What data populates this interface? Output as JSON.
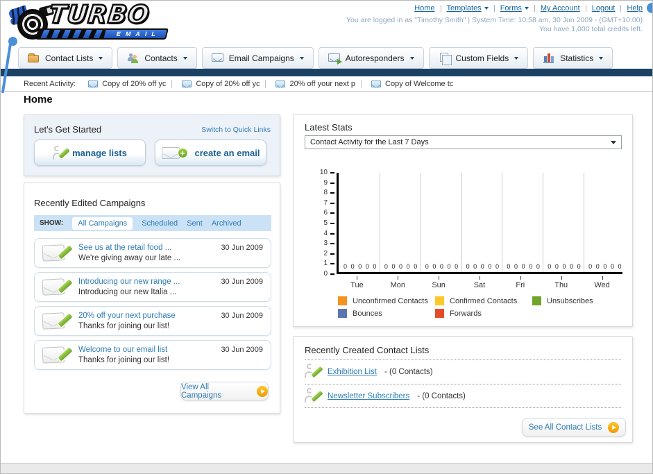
{
  "logo": {
    "title": "TURBO",
    "subtitle": "EMAIL"
  },
  "header": {
    "nav": [
      {
        "label": "Home",
        "dropdown": false
      },
      {
        "label": "Templates",
        "dropdown": true
      },
      {
        "label": "Forms",
        "dropdown": true
      },
      {
        "label": "My Account",
        "dropdown": false
      },
      {
        "label": "Logout",
        "dropdown": false
      },
      {
        "label": "Help",
        "dropdown": false
      }
    ],
    "login_info": "You are logged in as \"Timothy Smith\" | System Time: 10:58 am, 30 Jun 2009 - (GMT+10:00)",
    "credits_info": "You have 1,000 total credits left."
  },
  "tabs": [
    {
      "label": "Contact Lists"
    },
    {
      "label": "Contacts"
    },
    {
      "label": "Email Campaigns"
    },
    {
      "label": "Autoresponders"
    },
    {
      "label": "Custom Fields"
    },
    {
      "label": "Statistics"
    }
  ],
  "recent_activity": {
    "label": "Recent Activity:",
    "items": [
      {
        "text": "Copy of 20% off yc"
      },
      {
        "text": "Copy of 20% off yc"
      },
      {
        "text": "20% off your next p"
      },
      {
        "text": "Copy of Welcome tc"
      }
    ]
  },
  "page_title": "Home",
  "get_started": {
    "title": "Let's Get Started",
    "switch_link": "Switch to Quick Links",
    "manage_lists_label": "manage lists",
    "create_email_label": "create an email"
  },
  "campaigns_panel": {
    "title": "Recently Edited Campaigns",
    "show_label": "SHOW:",
    "filters": [
      {
        "label": "All Campaigns",
        "active": true
      },
      {
        "label": "Scheduled",
        "active": false
      },
      {
        "label": "Sent",
        "active": false
      },
      {
        "label": "Archived",
        "active": false
      }
    ],
    "rows": [
      {
        "title": "See us at the retail food ...",
        "subtitle": "We're giving away our late ...",
        "date": "30 Jun 2009"
      },
      {
        "title": "Introducing our new range ...",
        "subtitle": "Introducing our new Italia ...",
        "date": "30 Jun 2009"
      },
      {
        "title": "20% off your next purchase",
        "subtitle": "Thanks for joining our list!",
        "date": "30 Jun 2009"
      },
      {
        "title": "Welcome to our email list",
        "subtitle": "Thanks for joining our list!",
        "date": "30 Jun 2009"
      }
    ],
    "view_all_label": "View All Campaigns"
  },
  "stats_panel": {
    "title": "Latest Stats",
    "dropdown_value": "Contact Activity for the Last 7 Days"
  },
  "chart_data": {
    "type": "bar",
    "title": "Contact Activity for the Last 7 Days",
    "categories": [
      "Tue",
      "Mon",
      "Sun",
      "Sat",
      "Fri",
      "Thu",
      "Wed"
    ],
    "series": [
      {
        "name": "Unconfirmed Contacts",
        "color": "#F6921E",
        "values": [
          0,
          0,
          0,
          0,
          0,
          0,
          0
        ]
      },
      {
        "name": "Confirmed Contacts",
        "color": "#FBC92B",
        "values": [
          0,
          0,
          0,
          0,
          0,
          0,
          0
        ]
      },
      {
        "name": "Unsubscribes",
        "color": "#72A32B",
        "values": [
          0,
          0,
          0,
          0,
          0,
          0,
          0
        ]
      },
      {
        "name": "Bounces",
        "color": "#5B76AC",
        "values": [
          0,
          0,
          0,
          0,
          0,
          0,
          0
        ]
      },
      {
        "name": "Forwards",
        "color": "#E74C28",
        "values": [
          0,
          0,
          0,
          0,
          0,
          0,
          0
        ]
      }
    ],
    "ylim": [
      0,
      10
    ],
    "ytick_step": 1,
    "grid": true,
    "legend_position": "bottom",
    "xlabel": "",
    "ylabel": ""
  },
  "contact_lists_panel": {
    "title": "Recently Created Contact Lists",
    "items": [
      {
        "name": "Exhibition List",
        "detail": "- (0 Contacts)"
      },
      {
        "name": "Newsletter Subscribers",
        "detail": "- (0 Contacts)"
      }
    ],
    "see_all_label": "See All Contact Lists"
  },
  "colors": {
    "nav_bar": "#1b4265",
    "link_blue": "#2e7cb5",
    "accent_orange": "#ef9c02",
    "accent_green": "#6fa32b"
  }
}
